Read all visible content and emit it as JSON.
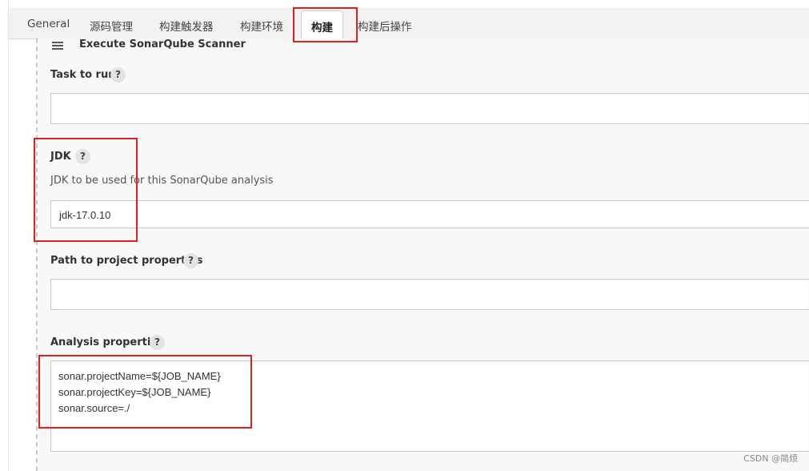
{
  "tabs": [
    {
      "label": "General"
    },
    {
      "label": "源码管理"
    },
    {
      "label": "构建触发器"
    },
    {
      "label": "构建环境"
    },
    {
      "label": "构建"
    },
    {
      "label": "构建后操作"
    }
  ],
  "active_tab": "构建",
  "step": {
    "title": "Execute SonarQube Scanner",
    "handle_icon": "drag-handle-icon"
  },
  "fields": {
    "task_to_run": {
      "label": "Task to run",
      "value": ""
    },
    "jdk": {
      "label": "JDK",
      "description": "JDK to be used for this SonarQube analysis",
      "value": "jdk-17.0.10"
    },
    "path_to_project_properties": {
      "label": "Path to project properties",
      "value": ""
    },
    "analysis_properties": {
      "label": "Analysis properties",
      "lines": [
        "sonar.projectName=${JOB_NAME}",
        "sonar.projectKey=${JOB_NAME}",
        "sonar.source=./"
      ]
    }
  },
  "help_glyph": "?",
  "highlight_color": "#e02020",
  "watermark": "CSDN @简烦"
}
